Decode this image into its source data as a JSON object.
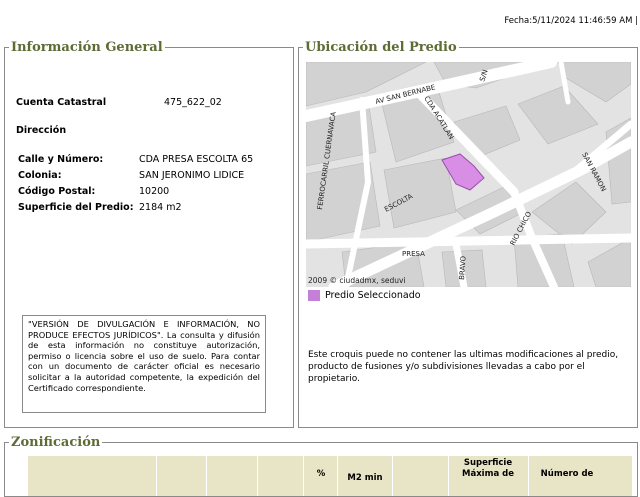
{
  "header": {
    "fecha": "Fecha:5/11/2024 11:46:59 AM |"
  },
  "info": {
    "title": "Información General",
    "cuenta_label": "Cuenta Catastral",
    "cuenta_value": "475_622_02",
    "direccion_label": "Dirección",
    "calle_label": "Calle y Número:",
    "calle_value": "CDA PRESA ESCOLTA 65",
    "colonia_label": "Colonia:",
    "colonia_value": "SAN JERONIMO LIDICE",
    "cp_label": "Código Postal:",
    "cp_value": "10200",
    "superficie_label": "Superficie del Predio:",
    "superficie_value": "2184 m2",
    "disclaimer": "\"VERSIÓN DE DIVULGACIÓN E INFORMACIÓN, NO PRODUCE EFECTOS JURÍDICOS\". La consulta y difusión de esta información no constituye autorización, permiso o licencia sobre el uso de suelo. Para contar con un documento de carácter oficial es necesario solicitar a la autoridad competente, la expedición del Certificado correspondiente."
  },
  "ubicacion": {
    "title": "Ubicación del Predio",
    "map_labels": {
      "av_san_bernabe": "AV SAN BERNABE",
      "sn": "S/N",
      "ferrocarril": "FERROCARRIL CUERNAVACA",
      "cda_acatlan": "CDA ACATLAN",
      "san_ramon": "SAN RAMON",
      "escolta": "ESCOLTA",
      "rio_chico": "RIO CHICO",
      "presa": "PRESA",
      "bravo": "BRAVO"
    },
    "credit": "2009 © ciudadmx, seduvi",
    "legend_label": "Predio Seleccionado",
    "legend_color": "#c47fd6",
    "note": "Este croquis puede no contener las ultimas modificaciones al predio, producto de fusiones y/o subdivisiones llevadas a cabo por el propietario."
  },
  "zonificacion": {
    "title": "Zonificación",
    "headers": {
      "pct": "%",
      "m2": "M2 min",
      "superficie": "Superficie Máxima de",
      "numero": "Número de"
    }
  }
}
